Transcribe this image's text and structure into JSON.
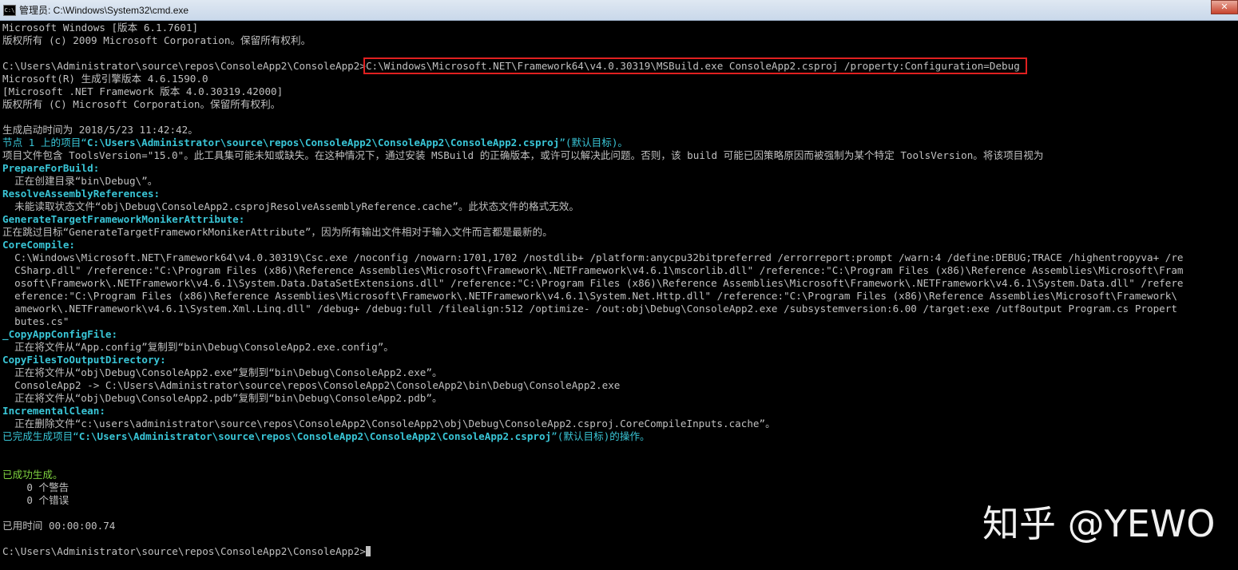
{
  "window": {
    "title": "管理员: C:\\Windows\\System32\\cmd.exe",
    "icon": "cmd-icon",
    "close": "✕"
  },
  "console": {
    "lines": [
      {
        "w": "Microsoft Windows [版本 6.1.7601]"
      },
      {
        "w": "版权所有 (c) 2009 Microsoft Corporation。保留所有权利。"
      },
      {
        "w": ""
      },
      {
        "w": "C:\\Users\\Administrator\\source\\repos\\ConsoleApp2\\ConsoleApp2>",
        "hl": "C:\\Windows\\Microsoft.NET\\Framework64\\v4.0.30319\\MSBuild.exe ConsoleApp2.csproj /property:Configuration=Debug"
      },
      {
        "w": "Microsoft(R) 生成引擎版本 4.6.1590.0"
      },
      {
        "w": "[Microsoft .NET Framework 版本 4.0.30319.42000]"
      },
      {
        "w": "版权所有 (C) Microsoft Corporation。保留所有权利。"
      },
      {
        "w": ""
      },
      {
        "w": "生成启动时间为 2018/5/23 11:42:42。"
      },
      {
        "c1": "节点 1 上的项目“",
        "cb": "C:\\Users\\Administrator\\source\\repos\\ConsoleApp2\\ConsoleApp2\\ConsoleApp2.csproj",
        "c2": "”(默认目标)。"
      },
      {
        "w": "项目文件包含 ToolsVersion=\"15.0\"。此工具集可能未知或缺失。在这种情况下，通过安装 MSBuild 的正确版本，或许可以解决此问题。否则，该 build 可能已因策略原因而被强制为某个特定 ToolsVersion。将该项目视为"
      },
      {
        "cb": "PrepareForBuild:"
      },
      {
        "w": "  正在创建目录“bin\\Debug\\”。"
      },
      {
        "cb": "ResolveAssemblyReferences:"
      },
      {
        "w": "  未能读取状态文件“obj\\Debug\\ConsoleApp2.csprojResolveAssemblyReference.cache”。此状态文件的格式无效。"
      },
      {
        "cb": "GenerateTargetFrameworkMonikerAttribute:"
      },
      {
        "w": "正在跳过目标“GenerateTargetFrameworkMonikerAttribute”，因为所有输出文件相对于输入文件而言都是最新的。"
      },
      {
        "cb": "CoreCompile:"
      },
      {
        "w": "  C:\\Windows\\Microsoft.NET\\Framework64\\v4.0.30319\\Csc.exe /noconfig /nowarn:1701,1702 /nostdlib+ /platform:anycpu32bitpreferred /errorreport:prompt /warn:4 /define:DEBUG;TRACE /highentropyva+ /re"
      },
      {
        "w": "  CSharp.dll\" /reference:\"C:\\Program Files (x86)\\Reference Assemblies\\Microsoft\\Framework\\.NETFramework\\v4.6.1\\mscorlib.dll\" /reference:\"C:\\Program Files (x86)\\Reference Assemblies\\Microsoft\\Fram"
      },
      {
        "w": "  osoft\\Framework\\.NETFramework\\v4.6.1\\System.Data.DataSetExtensions.dll\" /reference:\"C:\\Program Files (x86)\\Reference Assemblies\\Microsoft\\Framework\\.NETFramework\\v4.6.1\\System.Data.dll\" /refere"
      },
      {
        "w": "  eference:\"C:\\Program Files (x86)\\Reference Assemblies\\Microsoft\\Framework\\.NETFramework\\v4.6.1\\System.Net.Http.dll\" /reference:\"C:\\Program Files (x86)\\Reference Assemblies\\Microsoft\\Framework\\"
      },
      {
        "w": "  amework\\.NETFramework\\v4.6.1\\System.Xml.Linq.dll\" /debug+ /debug:full /filealign:512 /optimize- /out:obj\\Debug\\ConsoleApp2.exe /subsystemversion:6.00 /target:exe /utf8output Program.cs Propert"
      },
      {
        "w": "  butes.cs\""
      },
      {
        "cb": "_CopyAppConfigFile:"
      },
      {
        "w": "  正在将文件从“App.config”复制到“bin\\Debug\\ConsoleApp2.exe.config”。"
      },
      {
        "cb": "CopyFilesToOutputDirectory:"
      },
      {
        "w": "  正在将文件从“obj\\Debug\\ConsoleApp2.exe”复制到“bin\\Debug\\ConsoleApp2.exe”。"
      },
      {
        "w": "  ConsoleApp2 -> C:\\Users\\Administrator\\source\\repos\\ConsoleApp2\\ConsoleApp2\\bin\\Debug\\ConsoleApp2.exe"
      },
      {
        "w": "  正在将文件从“obj\\Debug\\ConsoleApp2.pdb”复制到“bin\\Debug\\ConsoleApp2.pdb”。"
      },
      {
        "cb": "IncrementalClean:"
      },
      {
        "w": "  正在删除文件“c:\\users\\administrator\\source\\repos\\ConsoleApp2\\ConsoleApp2\\obj\\Debug\\ConsoleApp2.csproj.CoreCompileInputs.cache”。"
      },
      {
        "c1": "已完成生成项目“",
        "cb": "C:\\Users\\Administrator\\source\\repos\\ConsoleApp2\\ConsoleApp2\\ConsoleApp2.csproj",
        "c2": "”(默认目标)的操作。"
      },
      {
        "w": ""
      },
      {
        "w": ""
      },
      {
        "g": "已成功生成。"
      },
      {
        "w": "    0 个警告"
      },
      {
        "w": "    0 个错误"
      },
      {
        "w": ""
      },
      {
        "w": "已用时间 00:00:00.74"
      },
      {
        "w": ""
      },
      {
        "w": "C:\\Users\\Administrator\\source\\repos\\ConsoleApp2\\ConsoleApp2>",
        "cursor": true
      }
    ]
  },
  "watermark": "知乎 @YEWO"
}
